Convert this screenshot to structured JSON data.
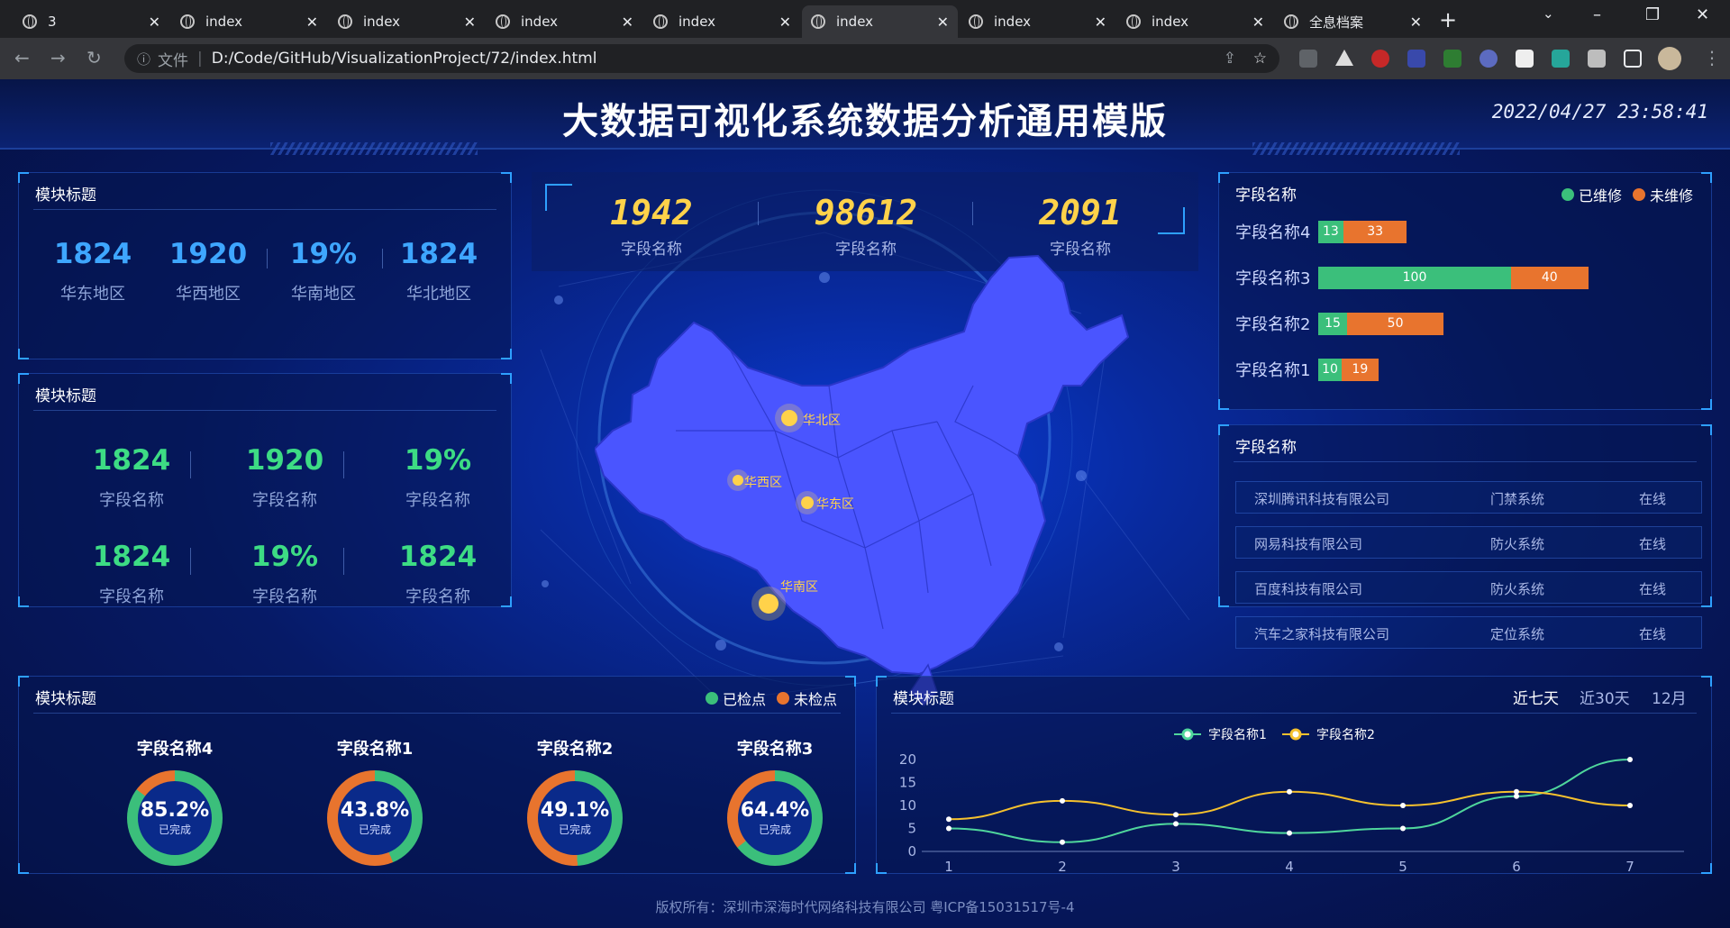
{
  "browser": {
    "tabs": [
      {
        "label": "3",
        "active": false
      },
      {
        "label": "index",
        "active": false
      },
      {
        "label": "index",
        "active": false
      },
      {
        "label": "index",
        "active": false
      },
      {
        "label": "index",
        "active": false
      },
      {
        "label": "index",
        "active": true
      },
      {
        "label": "index",
        "active": false
      },
      {
        "label": "index",
        "active": false
      },
      {
        "label": "全息档案",
        "active": false
      }
    ],
    "url_label": "文件",
    "url": "D:/Code/GitHub/VisualizationProject/72/index.html"
  },
  "dashboard": {
    "title": "大数据可视化系统数据分析通用模版",
    "datetime": "2022/04/27 23:58:41",
    "footer": "版权所有：深圳市深海时代网络科技有限公司 粤ICP备15031517号-4",
    "panel1": {
      "title": "模块标题",
      "stats": [
        {
          "value": "1824",
          "label": "华东地区"
        },
        {
          "value": "1920",
          "label": "华西地区"
        },
        {
          "value": "19%",
          "label": "华南地区"
        },
        {
          "value": "1824",
          "label": "华北地区"
        }
      ]
    },
    "panel2": {
      "title": "模块标题",
      "stats": [
        {
          "value": "1824",
          "label": "字段名称"
        },
        {
          "value": "1920",
          "label": "字段名称"
        },
        {
          "value": "19%",
          "label": "字段名称"
        },
        {
          "value": "1824",
          "label": "字段名称"
        },
        {
          "value": "19%",
          "label": "字段名称"
        },
        {
          "value": "1824",
          "label": "字段名称"
        }
      ]
    },
    "center_stats": [
      {
        "value": "1942",
        "label": "字段名称"
      },
      {
        "value": "98612",
        "label": "字段名称"
      },
      {
        "value": "2091",
        "label": "字段名称"
      }
    ],
    "map": {
      "points": [
        "华北区",
        "华西区",
        "华东区",
        "华南区"
      ]
    },
    "bar_panel": {
      "title": "字段名称",
      "legend": [
        "已维修",
        "未维修"
      ],
      "colors": {
        "done": "#3bbf7b",
        "todo": "#e8742e"
      },
      "rows": [
        {
          "name": "字段名称4",
          "done": 13,
          "todo": 33
        },
        {
          "name": "字段名称3",
          "done": 100,
          "todo": 40
        },
        {
          "name": "字段名称2",
          "done": 15,
          "todo": 50
        },
        {
          "name": "字段名称1",
          "done": 10,
          "todo": 19
        }
      ]
    },
    "table_panel": {
      "title": "字段名称",
      "rows": [
        [
          "深圳腾讯科技有限公司",
          "门禁系统",
          "在线"
        ],
        [
          "网易科技有限公司",
          "防火系统",
          "在线"
        ],
        [
          "百度科技有限公司",
          "防火系统",
          "在线"
        ],
        [
          "汽车之家科技有限公司",
          "定位系统",
          "在线"
        ]
      ]
    },
    "donut_panel": {
      "title": "模块标题",
      "legend": [
        "已检点",
        "未检点"
      ],
      "sub_label": "已完成",
      "items": [
        {
          "name": "字段名称4",
          "percent": "85.2%",
          "value": 85.2
        },
        {
          "name": "字段名称1",
          "percent": "43.8%",
          "value": 43.8
        },
        {
          "name": "字段名称2",
          "percent": "49.1%",
          "value": 49.1
        },
        {
          "name": "字段名称3",
          "percent": "64.4%",
          "value": 64.4
        }
      ]
    },
    "line_panel": {
      "title": "模块标题",
      "range_tabs": [
        "近七天",
        "近30天",
        "12月"
      ],
      "active_tab": "近七天"
    }
  },
  "chart_data": {
    "type": "line",
    "x": [
      1,
      2,
      3,
      4,
      5,
      6,
      7
    ],
    "series": [
      {
        "name": "字段名称1",
        "values": [
          5,
          2,
          6,
          4,
          5,
          12,
          20
        ],
        "color": "#4fd69c"
      },
      {
        "name": "字段名称2",
        "values": [
          7,
          11,
          8,
          13,
          10,
          13,
          10
        ],
        "color": "#f5c12e"
      }
    ],
    "ylim": [
      0,
      20
    ],
    "yticks": [
      0,
      5,
      10,
      15,
      20
    ],
    "grid": false,
    "legend": "top-center"
  }
}
